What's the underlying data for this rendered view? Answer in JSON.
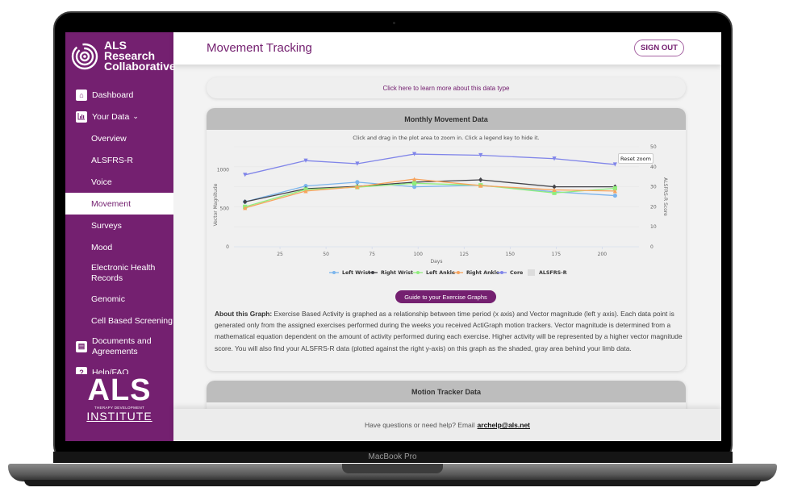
{
  "device": {
    "label": "MacBook Pro"
  },
  "sidebar": {
    "brand": {
      "line1": "ALS",
      "line2": "Research",
      "line3": "Collaborative"
    },
    "items": [
      {
        "label": "Dashboard",
        "type": "top",
        "icon": "home-icon"
      },
      {
        "label": "Your Data",
        "type": "top",
        "icon": "bar-chart-icon",
        "expanded": true
      },
      {
        "label": "Overview",
        "type": "sub"
      },
      {
        "label": "ALSFRS-R",
        "type": "sub"
      },
      {
        "label": "Voice",
        "type": "sub"
      },
      {
        "label": "Movement",
        "type": "sub",
        "active": true
      },
      {
        "label": "Surveys",
        "type": "sub"
      },
      {
        "label": "Mood",
        "type": "sub"
      },
      {
        "label": "Electronic Health Records",
        "type": "sub"
      },
      {
        "label": "Genomic",
        "type": "sub"
      },
      {
        "label": "Cell Based Screening",
        "type": "sub"
      },
      {
        "label": "Documents and Agreements",
        "type": "top",
        "icon": "document-icon"
      },
      {
        "label": "Help/FAQ",
        "type": "top",
        "icon": "help-icon"
      }
    ],
    "footer_logo": {
      "big": "ALS",
      "small": "THERAPY DEVELOPMENT",
      "institute": "INSTITUTE"
    }
  },
  "header": {
    "title": "Movement Tracking",
    "signout_label": "SIGN OUT"
  },
  "learn_more": "Click here to learn more about this data type",
  "monthly_card": {
    "title": "Monthly Movement Data",
    "subtitle": "Click and drag in the plot area to zoom in. Click a legend key to hide it.",
    "reset_zoom": "Reset zoom",
    "guide_button": "Guide to your Exercise Graphs",
    "about_label": "About this Graph:",
    "about_text": "Exercise Based Activity is graphed as a relationship between time period (x axis) and Vector magnitude (left y axis). Each data point is generated only from the assigned exercises performed during the weeks you received ActiGraph motion trackers. Vector magnitude is determined from a mathematical equation dependent on the amount of activity performed during each exercise. Higher activity will be represented by a higher vector magnitude score. You will also find your ALSFRS-R data (plotted against the right y-axis) on this graph as the shaded, gray area behind your limb data."
  },
  "motion_card": {
    "title": "Motion Tracker Data"
  },
  "footer": {
    "text": "Have questions or need help? Email",
    "email": "archelp@als.net"
  },
  "chart_data": {
    "type": "line",
    "title": "Monthly Movement Data",
    "xlabel": "Days",
    "ylabel": "Vector Magnitude",
    "y2label": "ALSFRS-R Score",
    "xlim": [
      0,
      220
    ],
    "ylim": [
      0,
      1300
    ],
    "y2lim": [
      0,
      50
    ],
    "xticks": [
      25,
      50,
      75,
      100,
      125,
      150,
      175,
      200
    ],
    "yticks": [
      0,
      500,
      1000
    ],
    "y2ticks": [
      0,
      10,
      20,
      30,
      40,
      50
    ],
    "grid": true,
    "legend": "bottom",
    "x": [
      6,
      39,
      67,
      98,
      134,
      174,
      207
    ],
    "series": [
      {
        "name": "Left Wrist",
        "color": "#7cb5ec",
        "marker": "circle",
        "values": [
          585,
          790,
          840,
          780,
          800,
          715,
          665
        ]
      },
      {
        "name": "Right Wrist",
        "color": "#434348",
        "marker": "diamond",
        "values": [
          585,
          755,
          785,
          840,
          870,
          780,
          780
        ]
      },
      {
        "name": "Left Ankle",
        "color": "#90ed7d",
        "marker": "square",
        "values": [
          520,
          745,
          775,
          825,
          800,
          700,
          760
        ]
      },
      {
        "name": "Right Ankle",
        "color": "#f7a35c",
        "marker": "triangle",
        "values": [
          505,
          725,
          780,
          880,
          795,
          740,
          725
        ]
      },
      {
        "name": "Core",
        "color": "#8085e9",
        "marker": "triangle-down",
        "values": [
          935,
          1120,
          1080,
          1205,
          1190,
          1145,
          1070
        ]
      }
    ],
    "alsfrs": {
      "name": "ALSFRS-R",
      "color": "#e6e6e6",
      "values": []
    }
  }
}
